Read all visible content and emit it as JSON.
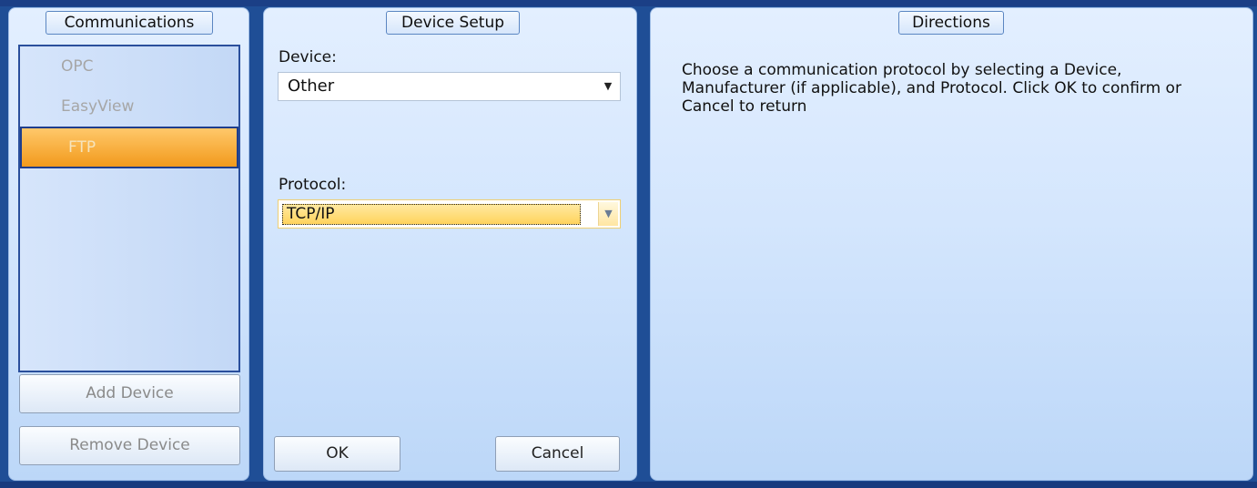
{
  "communications": {
    "title": "Communications",
    "devices": [
      "OPC",
      "EasyView",
      "FTP"
    ],
    "selected": "FTP",
    "add_device_label": "Add Device",
    "remove_device_label": "Remove Device"
  },
  "device_setup": {
    "title": "Device Setup",
    "device_label": "Device:",
    "device_value": "Other",
    "protocol_label": "Protocol:",
    "protocol_value": "TCP/IP",
    "ok_label": "OK",
    "cancel_label": "Cancel"
  },
  "directions": {
    "title": "Directions",
    "text": "Choose a communication protocol by selecting a Device, Manufacturer (if applicable), and Protocol. Click OK to confirm or Cancel to return"
  },
  "colors": {
    "frame": "#1f4e96",
    "selection": "#f29a1c",
    "focus_highlight": "#ffd35c"
  }
}
